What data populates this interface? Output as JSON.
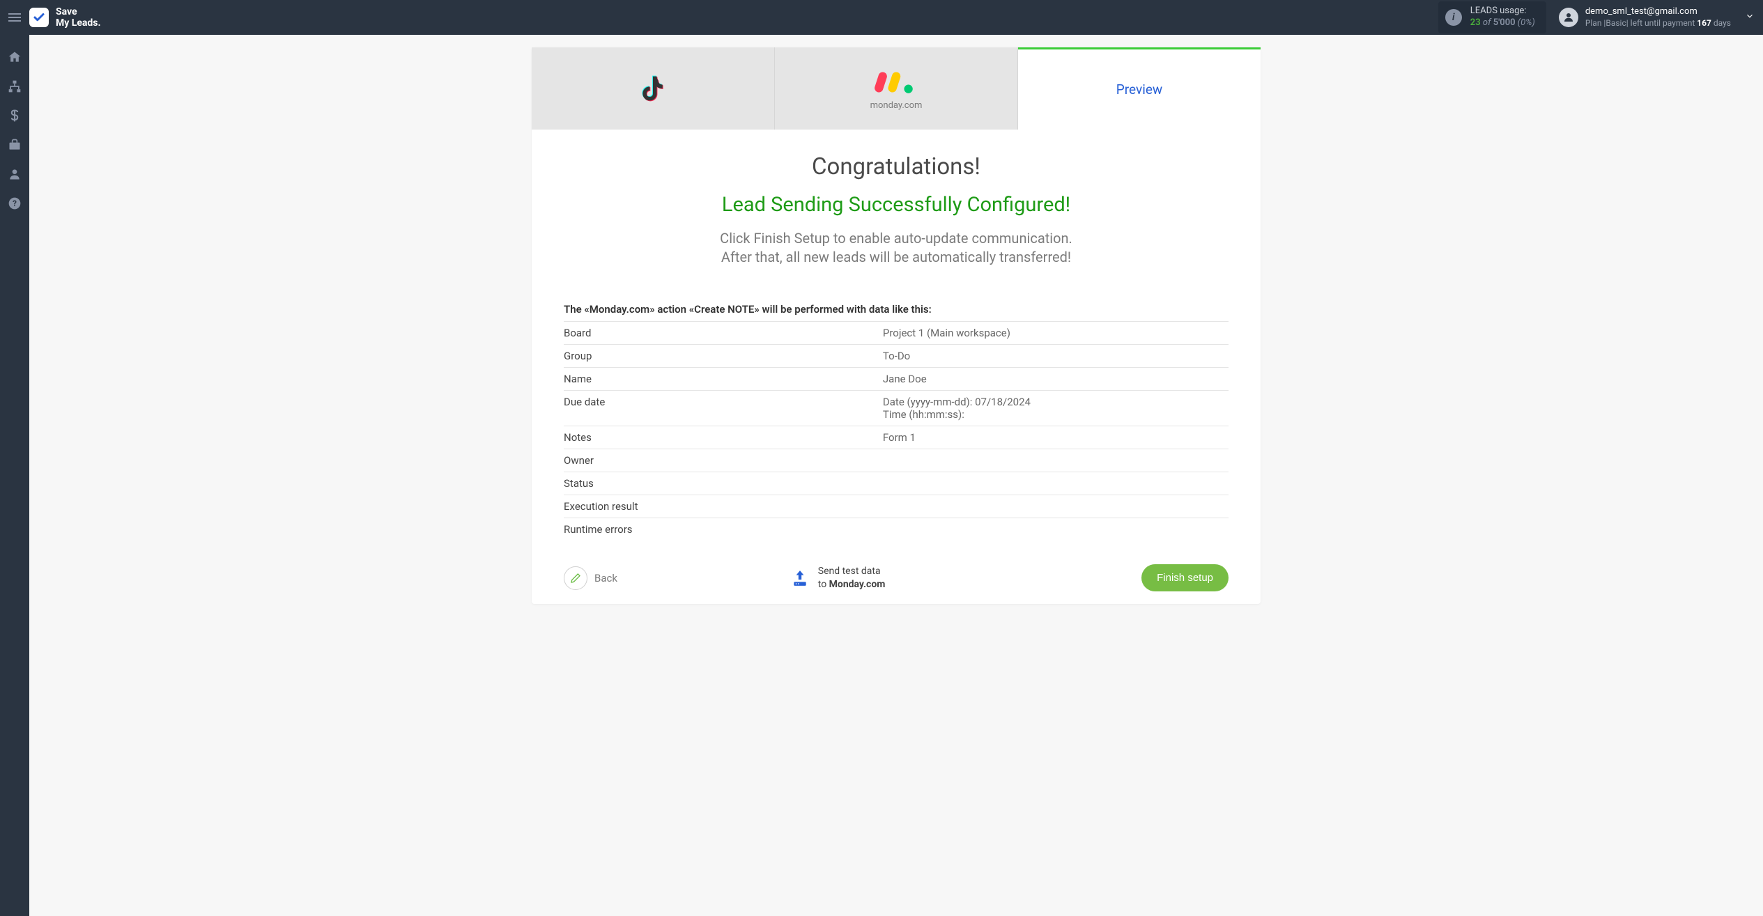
{
  "brand": {
    "line1": "Save",
    "line2": "My Leads."
  },
  "usage": {
    "label": "LEADS usage:",
    "current": "23",
    "of": "of",
    "total": "5'000",
    "percent": "(0%)"
  },
  "user": {
    "email": "demo_sml_test@gmail.com",
    "plan_prefix": "Plan |Basic| left until payment ",
    "days": "167",
    "days_suffix": " days"
  },
  "tabs": {
    "monday_label": "monday.com",
    "preview": "Preview"
  },
  "congrats": {
    "title": "Congratulations!",
    "subtitle": "Lead Sending Successfully Configured!",
    "desc1": "Click Finish Setup to enable auto-update communication.",
    "desc2": "After that, all new leads will be automatically transferred!"
  },
  "action_desc": "The «Monday.com» action «Create NOTE» will be performed with data like this:",
  "rows": [
    {
      "k": "Board",
      "v": "Project 1 (Main workspace)"
    },
    {
      "k": "Group",
      "v": "To-Do"
    },
    {
      "k": "Name",
      "v": "Jane Doe"
    },
    {
      "k": "Due date",
      "v": "Date (yyyy-mm-dd): 07/18/2024\nTime (hh:mm:ss):"
    },
    {
      "k": "Notes",
      "v": "Form 1"
    },
    {
      "k": "Owner",
      "v": ""
    },
    {
      "k": "Status",
      "v": ""
    },
    {
      "k": "Execution result",
      "v": ""
    },
    {
      "k": "Runtime errors",
      "v": ""
    }
  ],
  "footer": {
    "back": "Back",
    "send_line1": "Send test data",
    "send_line2_prefix": "to ",
    "send_line2_bold": "Monday.com",
    "finish": "Finish setup"
  }
}
